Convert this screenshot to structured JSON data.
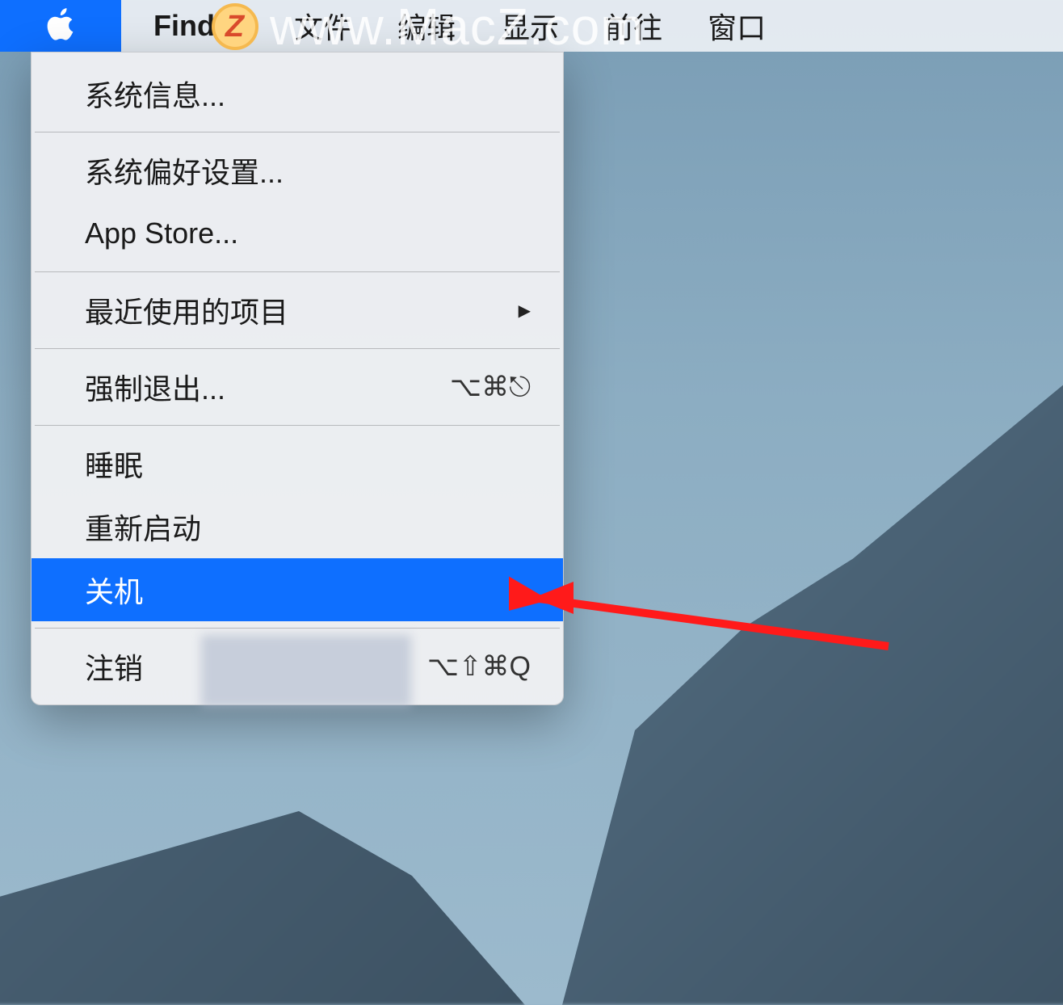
{
  "menubar": {
    "app_name": "Finder",
    "items": [
      "文件",
      "编辑",
      "显示",
      "前往",
      "窗口"
    ]
  },
  "apple_menu": {
    "items": [
      {
        "label": "系统信息...",
        "shortcut": "",
        "submenu": false,
        "selected": false
      },
      {
        "sep": true
      },
      {
        "label": "系统偏好设置...",
        "shortcut": "",
        "submenu": false,
        "selected": false
      },
      {
        "label": "App Store...",
        "shortcut": "",
        "submenu": false,
        "selected": false
      },
      {
        "sep": true
      },
      {
        "label": "最近使用的项目",
        "shortcut": "",
        "submenu": true,
        "selected": false
      },
      {
        "sep": true
      },
      {
        "label": "强制退出...",
        "shortcut": "⌥⌘⎋",
        "submenu": false,
        "selected": false
      },
      {
        "sep": true
      },
      {
        "label": "睡眠",
        "shortcut": "",
        "submenu": false,
        "selected": false
      },
      {
        "label": "重新启动",
        "shortcut": "",
        "submenu": false,
        "selected": false
      },
      {
        "label": "关机",
        "shortcut": "",
        "submenu": false,
        "selected": true
      },
      {
        "sep": true
      },
      {
        "label": "注销",
        "shortcut": "⌥⇧⌘Q",
        "submenu": false,
        "selected": false
      }
    ]
  },
  "watermark": {
    "badge": "Z",
    "text": "www.MacZ.com"
  }
}
